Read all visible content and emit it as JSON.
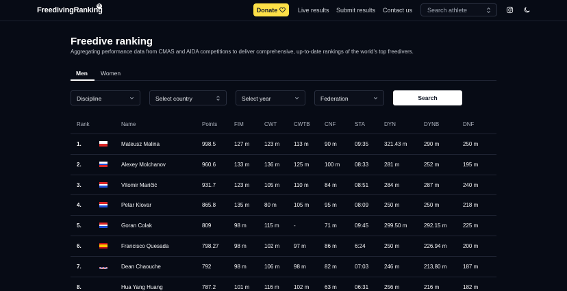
{
  "header": {
    "logo": "FreedivingRanking",
    "logo_badge": "®",
    "donate_label": "Donate",
    "nav": [
      "Live results",
      "Submit results",
      "Contact us"
    ],
    "search_placeholder": "Search athlete"
  },
  "page": {
    "title": "Freedive ranking",
    "subtitle": "Aggregating performance data from CMAS and AIDA competitions to deliver comprehensive, up-to-date rankings of the world's top freedivers."
  },
  "tabs": [
    {
      "label": "Men",
      "active": true
    },
    {
      "label": "Women",
      "active": false
    }
  ],
  "filters": {
    "discipline": "Discipline",
    "country": "Select country",
    "year": "Select year",
    "federation": "Federation",
    "search_label": "Search"
  },
  "table": {
    "headers": [
      "Rank",
      "Name",
      "Points",
      "FIM",
      "CWT",
      "CWTB",
      "CNF",
      "STA",
      "DYN",
      "DYNB",
      "DNF"
    ],
    "rows": [
      {
        "rank": "1.",
        "flag": "poland",
        "name": "Mateusz Malina",
        "points": "998.5",
        "fim": "127 m",
        "cwt": "123 m",
        "cwtb": "113 m",
        "cnf": "90 m",
        "sta": "09:35",
        "dyn": "321.43 m",
        "dynb": "290 m",
        "dnf": "250 m"
      },
      {
        "rank": "2.",
        "flag": "russia",
        "name": "Alexey Molchanov",
        "points": "960.6",
        "fim": "133 m",
        "cwt": "136 m",
        "cwtb": "125 m",
        "cnf": "100 m",
        "sta": "08:33",
        "dyn": "281 m",
        "dynb": "252 m",
        "dnf": "195 m"
      },
      {
        "rank": "3.",
        "flag": "croatia",
        "name": "Vitomir Maričić",
        "points": "931.7",
        "fim": "123 m",
        "cwt": "105 m",
        "cwtb": "110 m",
        "cnf": "84 m",
        "sta": "08:51",
        "dyn": "284 m",
        "dynb": "287 m",
        "dnf": "240 m"
      },
      {
        "rank": "4.",
        "flag": "croatia",
        "name": "Petar Klovar",
        "points": "865.8",
        "fim": "135 m",
        "cwt": "80 m",
        "cwtb": "105 m",
        "cnf": "95 m",
        "sta": "08:09",
        "dyn": "250 m",
        "dynb": "250 m",
        "dnf": "218 m"
      },
      {
        "rank": "5.",
        "flag": "croatia",
        "name": "Goran Colak",
        "points": "809",
        "fim": "98 m",
        "cwt": "115 m",
        "cwtb": "-",
        "cnf": "71 m",
        "sta": "09:45",
        "dyn": "299.50 m",
        "dynb": "292.15 m",
        "dnf": "225 m"
      },
      {
        "rank": "6.",
        "flag": "spain",
        "name": "Francisco Quesada",
        "points": "798.27",
        "fim": "98 m",
        "cwt": "102 m",
        "cwtb": "97 m",
        "cnf": "86 m",
        "sta": "6:24",
        "dyn": "250 m",
        "dynb": "226.94 m",
        "dnf": "200 m"
      },
      {
        "rank": "7.",
        "flag": "uk",
        "name": "Dean Chaouche",
        "points": "792",
        "fim": "98 m",
        "cwt": "106 m",
        "cwtb": "98 m",
        "cnf": "82 m",
        "sta": "07:03",
        "dyn": "246 m",
        "dynb": "213,80 m",
        "dnf": "187 m"
      },
      {
        "rank": "8.",
        "flag": "",
        "name": "Hua Yang Huang",
        "points": "787.2",
        "fim": "101 m",
        "cwt": "116 m",
        "cwtb": "102 m",
        "cnf": "63 m",
        "sta": "06:31",
        "dyn": "256 m",
        "dynb": "216 m",
        "dnf": "182 m"
      }
    ]
  },
  "colors": {
    "background": "#070b15",
    "accent": "#fde047",
    "border": "#1f2433"
  }
}
